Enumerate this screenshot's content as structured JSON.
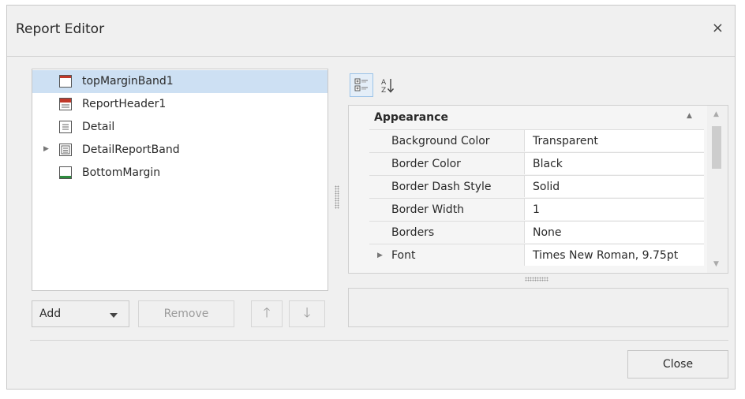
{
  "dialog": {
    "title": "Report Editor",
    "close_glyph": "×"
  },
  "bands": [
    {
      "label": "topMarginBand1",
      "icon": "top-margin-band-icon",
      "selected": true,
      "expandable": false
    },
    {
      "label": "ReportHeader1",
      "icon": "report-header-band-icon",
      "selected": false,
      "expandable": false
    },
    {
      "label": "Detail",
      "icon": "detail-band-icon",
      "selected": false,
      "expandable": false
    },
    {
      "label": "DetailReportBand",
      "icon": "detail-report-band-icon",
      "selected": false,
      "expandable": true
    },
    {
      "label": "BottomMargin",
      "icon": "bottom-margin-band-icon",
      "selected": false,
      "expandable": false
    }
  ],
  "actions": {
    "add_label": "Add",
    "remove_label": "Remove",
    "up_glyph": "🡑",
    "down_glyph": "🡓"
  },
  "toolbar": {
    "categorized_icon": "categorized-view-icon",
    "alphabetical_icon": "sort-az-icon"
  },
  "property_grid": {
    "category": "Appearance",
    "properties": [
      {
        "name": "Background Color",
        "value": "Transparent",
        "expandable": false
      },
      {
        "name": "Border Color",
        "value": "Black",
        "expandable": false
      },
      {
        "name": "Border Dash Style",
        "value": "Solid",
        "expandable": false
      },
      {
        "name": "Border Width",
        "value": "1",
        "expandable": false
      },
      {
        "name": "Borders",
        "value": "None",
        "expandable": false
      },
      {
        "name": "Font",
        "value": "Times New Roman, 9.75pt",
        "expandable": true
      }
    ]
  },
  "footer": {
    "close_label": "Close"
  },
  "colors": {
    "selection": "#cde0f3",
    "dialog_bg": "#f0f0f0",
    "accent": "#9cc3e8"
  }
}
